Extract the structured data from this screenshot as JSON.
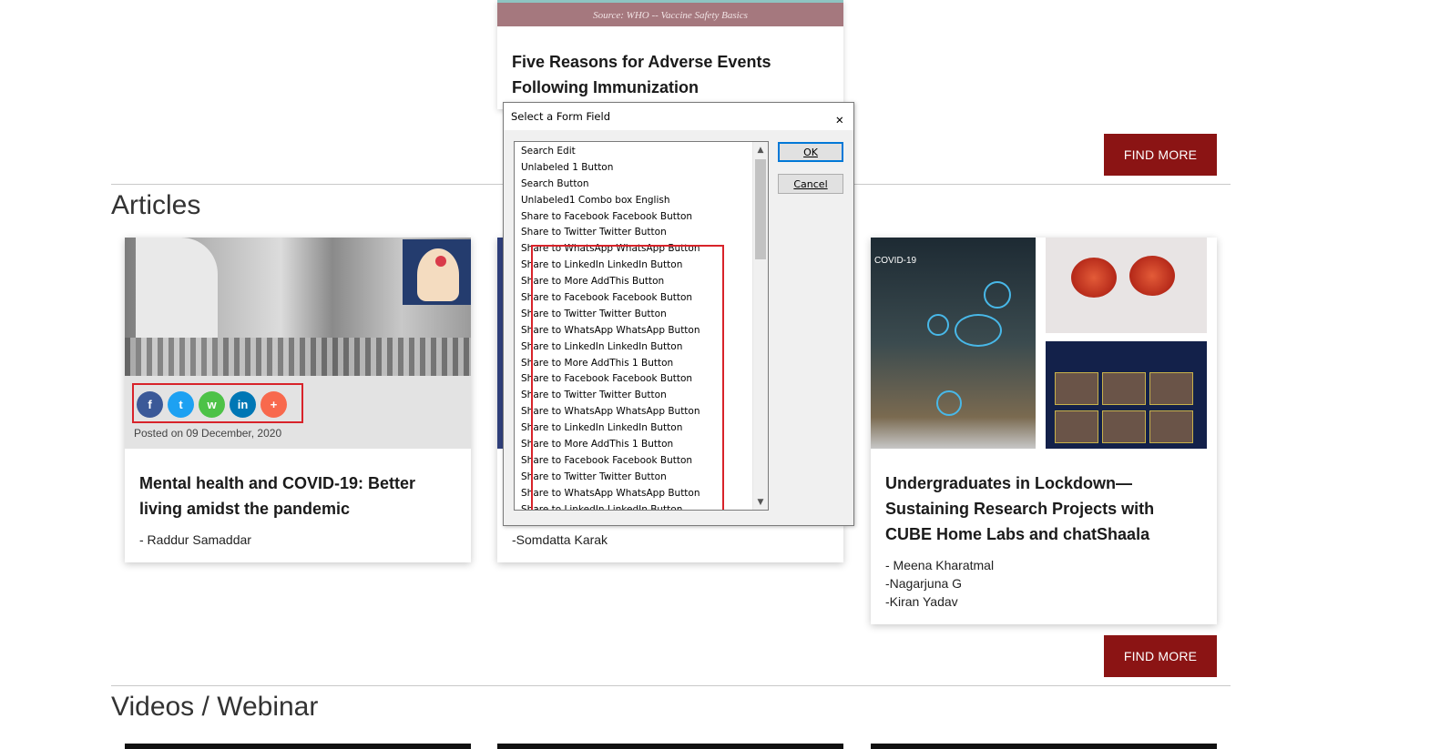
{
  "top_card": {
    "source_caption": "Source: WHO -- Vaccine Safety Basics",
    "title": "Five Reasons for Adverse Events Following Immunization"
  },
  "find_more_label": "FIND MORE",
  "sections": {
    "articles": "Articles",
    "videos": "Videos / Webinar"
  },
  "articles": [
    {
      "title": "Mental health and COVID-19: Better living amidst the pandemic",
      "posted": "Posted on 09 December, 2020",
      "authors": [
        "- Raddur Samaddar"
      ]
    },
    {
      "title": "",
      "authors": [
        "-Somdatta Karak"
      ]
    },
    {
      "title": "Undergraduates in Lockdown— Sustaining Research Projects with CUBE Home Labs and chatShaala",
      "authors": [
        "- Meena Kharatmal",
        "-Nagarjuna G",
        "-Kiran Yadav"
      ],
      "image_label": "COVID-19"
    }
  ],
  "share_buttons": [
    {
      "name": "facebook",
      "glyph": "f",
      "color": "#3b5998"
    },
    {
      "name": "twitter",
      "glyph": "t",
      "color": "#1da1f2"
    },
    {
      "name": "whatsapp",
      "glyph": "w",
      "color": "#4dc247"
    },
    {
      "name": "linkedin",
      "glyph": "in",
      "color": "#0077b5"
    },
    {
      "name": "addthis",
      "glyph": "+",
      "color": "#f8694d"
    }
  ],
  "dialog": {
    "title": "Select a Form Field",
    "ok_label": "OK",
    "cancel_label": "Cancel",
    "items": [
      "Search Edit",
      "Unlabeled 1 Button",
      "Search Button",
      "Unlabeled1 Combo box English",
      "Share to Facebook Facebook Button",
      "Share to Twitter Twitter Button",
      "Share to WhatsApp WhatsApp Button",
      "Share to LinkedIn LinkedIn Button",
      "Share to More AddThis Button",
      "Share to Facebook Facebook Button",
      "Share to Twitter Twitter Button",
      "Share to WhatsApp WhatsApp Button",
      "Share to LinkedIn LinkedIn Button",
      "Share to More AddThis 1 Button",
      "Share to Facebook Facebook Button",
      "Share to Twitter Twitter Button",
      "Share to WhatsApp WhatsApp Button",
      "Share to LinkedIn LinkedIn Button",
      "Share to More AddThis 1 Button",
      "Share to Facebook Facebook Button",
      "Share to Twitter Twitter Button",
      "Share to WhatsApp WhatsApp Button",
      "Share to LinkedIn LinkedIn Button"
    ]
  }
}
